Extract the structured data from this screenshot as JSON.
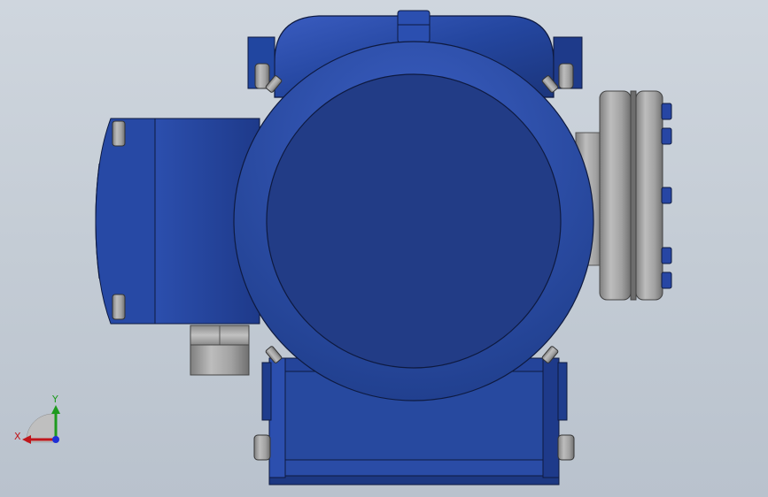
{
  "triad": {
    "x_label": "X",
    "y_label": "Y",
    "x_color": "#c0161b",
    "y_color": "#1e9a1e",
    "z_color": "#1f2fd6"
  },
  "model": {
    "body_color": "#23449b",
    "face_color": "#223c86",
    "metal_color": "#9c9c9c"
  }
}
